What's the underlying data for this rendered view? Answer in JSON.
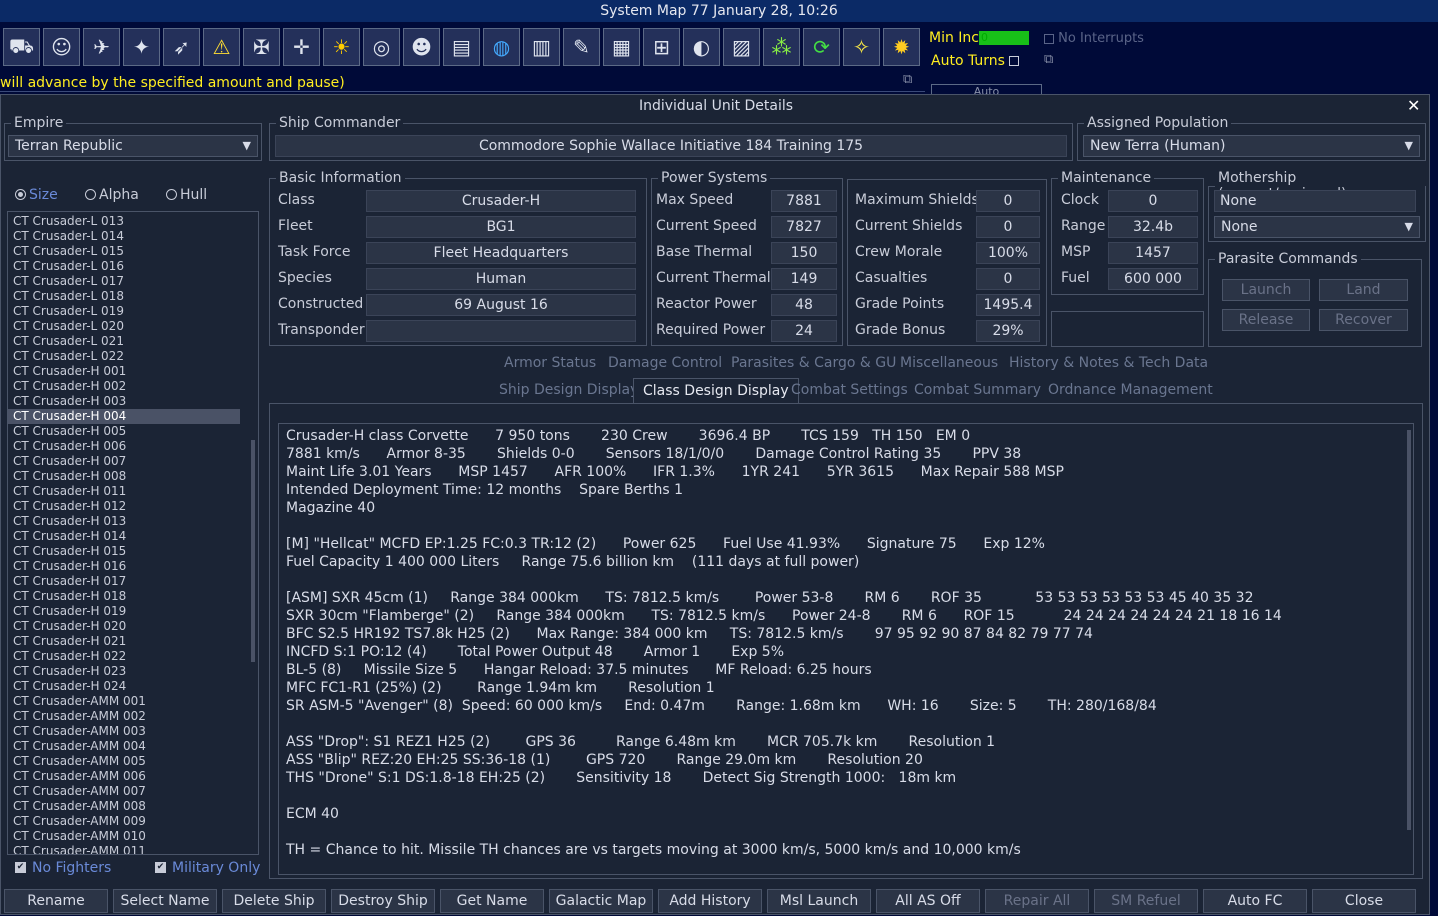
{
  "window": {
    "title": "System Map  77 January 28, 10:26",
    "dialog_title": "Individual Unit Details"
  },
  "toolbar": {
    "icons": [
      "tank-icon",
      "commander-icon",
      "ship-design-icon",
      "fighter-icon",
      "missile-icon",
      "warning-icon",
      "ship-icon",
      "target-icon",
      "sun-icon",
      "radar-icon",
      "alien-icon",
      "document-icon",
      "globe-icon",
      "barrels-icon",
      "wrench-icon",
      "buildings-icon",
      "network-icon",
      "planet-icon",
      "chart-icon",
      "cluster-icon",
      "refresh-icon",
      "map-icon",
      "gear-icon"
    ],
    "min_inc_label": "Min Inc",
    "min_inc_value": "0",
    "auto_turns_label": "Auto Turns",
    "no_interrupts_label": "No Interrupts",
    "marquee": "will advance by the specified amount and pause)",
    "auto_label": "Auto"
  },
  "empire": {
    "label": "Empire",
    "value": "Terran Republic"
  },
  "commander": {
    "label": "Ship Commander",
    "value": "Commodore Sophie Wallace   Initiative 184   Training 175"
  },
  "population": {
    "label": "Assigned Population",
    "value": "New Terra (Human)"
  },
  "sort": {
    "size": "Size",
    "alpha": "Alpha",
    "hull": "Hull"
  },
  "ship_list": [
    "CT Crusader-L 013",
    "CT Crusader-L 014",
    "CT Crusader-L 015",
    "CT Crusader-L 016",
    "CT Crusader-L 017",
    "CT Crusader-L 018",
    "CT Crusader-L 019",
    "CT Crusader-L 020",
    "CT Crusader-L 021",
    "CT Crusader-L 022",
    "CT Crusader-H 001",
    "CT Crusader-H 002",
    "CT Crusader-H 003",
    "CT Crusader-H 004",
    "CT Crusader-H 005",
    "CT Crusader-H 006",
    "CT Crusader-H 007",
    "CT Crusader-H 008",
    "CT Crusader-H 011",
    "CT Crusader-H 012",
    "CT Crusader-H 013",
    "CT Crusader-H 014",
    "CT Crusader-H 015",
    "CT Crusader-H 016",
    "CT Crusader-H 017",
    "CT Crusader-H 018",
    "CT Crusader-H 019",
    "CT Crusader-H 020",
    "CT Crusader-H 021",
    "CT Crusader-H 022",
    "CT Crusader-H 023",
    "CT Crusader-H 024",
    "CT Crusader-AMM 001",
    "CT Crusader-AMM 002",
    "CT Crusader-AMM 003",
    "CT Crusader-AMM 004",
    "CT Crusader-AMM 005",
    "CT Crusader-AMM 006",
    "CT Crusader-AMM 007",
    "CT Crusader-AMM 008",
    "CT Crusader-AMM 009",
    "CT Crusader-AMM 010",
    "CT Crusader-AMM 011"
  ],
  "selected_ship": "CT Crusader-H 004",
  "filters": {
    "no_fighters": "No Fighters",
    "military_only": "Military Only"
  },
  "basic": {
    "label": "Basic Information",
    "rows": [
      {
        "k": "Class",
        "v": "Crusader-H"
      },
      {
        "k": "Fleet",
        "v": "BG1"
      },
      {
        "k": "Task Force",
        "v": "Fleet Headquarters"
      },
      {
        "k": "Species",
        "v": "Human"
      },
      {
        "k": "Constructed",
        "v": "69 August 16"
      },
      {
        "k": "Transponder",
        "v": ""
      }
    ]
  },
  "power": {
    "label": "Power Systems",
    "rows": [
      {
        "k": "Max Speed",
        "v": "7881"
      },
      {
        "k": "Current Speed",
        "v": "7827"
      },
      {
        "k": "Base Thermal",
        "v": "150"
      },
      {
        "k": "Current Thermal",
        "v": "149"
      },
      {
        "k": "Reactor Power",
        "v": "48"
      },
      {
        "k": "Required Power",
        "v": "24"
      }
    ]
  },
  "shields": {
    "rows": [
      {
        "k": "Maximum Shields",
        "v": "0"
      },
      {
        "k": "Current Shields",
        "v": "0"
      },
      {
        "k": "Crew Morale",
        "v": "100%"
      },
      {
        "k": "Casualties",
        "v": "0"
      },
      {
        "k": "Grade Points",
        "v": "1495.4"
      },
      {
        "k": "Grade Bonus",
        "v": "29%"
      }
    ]
  },
  "maintenance": {
    "label": "Maintenance",
    "rows": [
      {
        "k": "Clock",
        "v": "0"
      },
      {
        "k": "Range",
        "v": "32.4b"
      },
      {
        "k": "MSP",
        "v": "1457"
      },
      {
        "k": "Fuel",
        "v": "600 000"
      }
    ]
  },
  "mothership": {
    "label": "Mothership (current/assigned)",
    "current": "None",
    "assigned": "None"
  },
  "parasite": {
    "label": "Parasite Commands",
    "launch": "Launch",
    "land": "Land",
    "release": "Release",
    "recover": "Recover"
  },
  "tabs_row1": [
    "Armor Status",
    "Damage Control",
    "Parasites & Cargo & GU",
    "Miscellaneous",
    "History & Notes & Tech Data"
  ],
  "tabs_row2": [
    "Ship Design Display",
    "Class Design Display",
    "Combat Settings",
    "Combat Summary",
    "Ordnance Management"
  ],
  "design_text": [
    "Crusader-H class Corvette      7 950 tons       230 Crew       3696.4 BP       TCS 159   TH 150   EM 0",
    "7881 km/s      Armor 8-35       Shields 0-0       Sensors 18/1/0/0       Damage Control Rating 35       PPV 38",
    "Maint Life 3.01 Years      MSP 1457      AFR 100%      IFR 1.3%      1YR 241      5YR 3615      Max Repair 588 MSP",
    "Intended Deployment Time: 12 months    Spare Berths 1",
    "Magazine 40",
    "",
    "[M] \"Hellcat\" MCFD EP:1.25 FC:0.3 TR:12 (2)      Power 625      Fuel Use 41.93%      Signature 75      Exp 12%",
    "Fuel Capacity 1 400 000 Liters     Range 75.6 billion km    (111 days at full power)",
    "",
    "[ASM] SXR 45cm (1)     Range 384 000km      TS: 7812.5 km/s        Power 53-8       RM 6       ROF 35            53 53 53 53 53 53 45 40 35 32",
    "SXR 30cm \"Flamberge\" (2)     Range 384 000km      TS: 7812.5 km/s      Power 24-8       RM 6      ROF 15           24 24 24 24 24 24 21 18 16 14",
    "BFC S2.5 HR192 TS7.8k H25 (2)      Max Range: 384 000 km     TS: 7812.5 km/s       97 95 92 90 87 84 82 79 77 74",
    "INCFD S:1 PO:12 (4)       Total Power Output 48       Armor 1       Exp 5%",
    "BL-5 (8)     Missile Size 5      Hangar Reload: 37.5 minutes      MF Reload: 6.25 hours",
    "MFC FC1-R1 (25%) (2)        Range 1.94m km       Resolution 1",
    "SR ASM-5 \"Avenger\" (8)  Speed: 60 000 km/s     End: 0.47m       Range: 1.68m km      WH: 16       Size: 5       TH: 280/168/84",
    "",
    "ASS \"Drop\": S1 REZ1 H25 (2)        GPS 36         Range 6.48m km       MCR 705.7k km       Resolution 1",
    "ASS \"Blip\" REZ:20 EH:25 SS:36-18 (1)        GPS 720       Range 29.0m km       Resolution 20",
    "THS \"Drone\" S:1 DS:1.8-18 EH:25 (2)       Sensitivity 18       Detect Sig Strength 1000:   18m km",
    "",
    "ECM 40",
    "",
    "TH = Chance to hit. Missile TH chances are vs targets moving at 3000 km/s, 5000 km/s and 10,000 km/s"
  ],
  "bottom_buttons": [
    {
      "label": "Rename",
      "enabled": true
    },
    {
      "label": "Select Name",
      "enabled": true
    },
    {
      "label": "Delete Ship",
      "enabled": true
    },
    {
      "label": "Destroy Ship",
      "enabled": true
    },
    {
      "label": "Get Name",
      "enabled": true
    },
    {
      "label": "Galactic Map",
      "enabled": true
    },
    {
      "label": "Add History",
      "enabled": true
    },
    {
      "label": "Msl Launch",
      "enabled": true
    },
    {
      "label": "All AS Off",
      "enabled": true
    },
    {
      "label": "Repair All",
      "enabled": false
    },
    {
      "label": "SM Refuel",
      "enabled": false
    },
    {
      "label": "Auto FC",
      "enabled": true
    },
    {
      "label": "Close",
      "enabled": true
    }
  ],
  "colors": {
    "accent_yellow": "#ffee20",
    "bg": "#1b2435",
    "field": "#2b3446",
    "top_bg": "#000a38"
  }
}
